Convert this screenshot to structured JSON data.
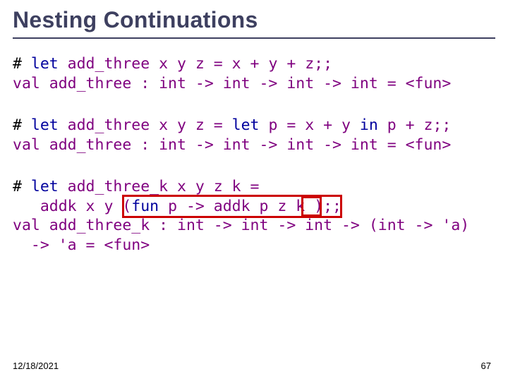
{
  "title": "Nesting Continuations",
  "block1": {
    "l1_a": "# ",
    "l1_b": "let ",
    "l1_c": "add_three x y z = x + y + z;;",
    "l2_a": "val add_three : int -> int -> int -> int = <fun>"
  },
  "block2": {
    "l1_a": "# ",
    "l1_b": "let ",
    "l1_c": "add_three x y z = ",
    "l1_d": "let ",
    "l1_e": "p = x + y ",
    "l1_f": "in ",
    "l1_g": "p + z;;",
    "l2_a": "val add_three : int -> int -> int -> int = <fun>"
  },
  "block3": {
    "l1_a": "# ",
    "l1_b": "let ",
    "l1_c": "add_three_k x y z k =",
    "l2_a": "   addk x y (",
    "l2_b": "fun ",
    "l2_c": "p -> addk p z k );;",
    "l3_a": "val add_three_k : int -> int -> int -> (int -> 'a)",
    "l4_a": "  -> 'a = <fun>"
  },
  "footer": {
    "date": "12/18/2021",
    "page": "67"
  }
}
